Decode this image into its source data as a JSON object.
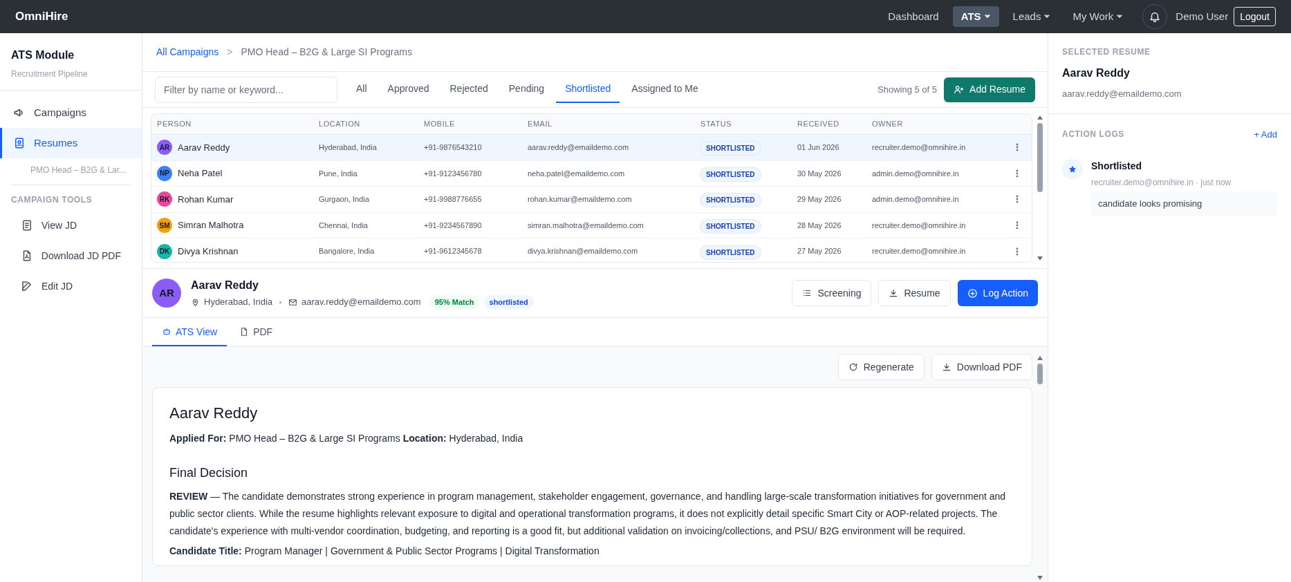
{
  "app": {
    "brand": "OmniHire",
    "nav": [
      {
        "label": "Dashboard",
        "selected": false,
        "dropdown": false
      },
      {
        "label": "ATS",
        "selected": true,
        "dropdown": true
      },
      {
        "label": "Leads",
        "selected": false,
        "dropdown": true
      },
      {
        "label": "My Work",
        "selected": false,
        "dropdown": true
      }
    ],
    "user": "Demo User",
    "logout": "Logout"
  },
  "sidebar": {
    "title": "ATS Module",
    "subtitle": "Recruitment Pipeline",
    "items": [
      {
        "label": "Campaigns",
        "selected": false
      },
      {
        "label": "Resumes",
        "selected": true
      }
    ],
    "sub_item": "PMO Head – B2G & Lar...",
    "tools_heading": "CAMPAIGN TOOLS",
    "tools": [
      {
        "label": "View JD"
      },
      {
        "label": "Download JD PDF"
      },
      {
        "label": "Edit JD"
      }
    ]
  },
  "breadcrumb": {
    "link": "All Campaigns",
    "separator": ">",
    "current": "PMO Head – B2G & Large SI Programs"
  },
  "filter": {
    "placeholder": "Filter by name or keyword...",
    "tabs": [
      {
        "label": "All",
        "selected": false
      },
      {
        "label": "Approved",
        "selected": false
      },
      {
        "label": "Rejected",
        "selected": false
      },
      {
        "label": "Pending",
        "selected": false
      },
      {
        "label": "Shortlisted",
        "selected": true
      },
      {
        "label": "Assigned to Me",
        "selected": false
      }
    ],
    "count": "Showing 5 of 5",
    "add_button": "Add Resume"
  },
  "table": {
    "columns": [
      "PERSON",
      "LOCATION",
      "MOBILE",
      "EMAIL",
      "STATUS",
      "RECEIVED",
      "OWNER"
    ],
    "rows": [
      {
        "initials": "AR",
        "color": "#8b5cf6",
        "name": "Aarav Reddy",
        "location": "Hyderabad, India",
        "mobile": "+91-9876543210",
        "email": "aarav.reddy@emaildemo.com",
        "status": "SHORTLISTED",
        "received": "01 Jun 2026",
        "owner": "recruiter.demo@omnihire.in",
        "selected": true
      },
      {
        "initials": "NP",
        "color": "#3b82f6",
        "name": "Neha Patel",
        "location": "Pune, India",
        "mobile": "+91-9123456780",
        "email": "neha.patel@emaildemo.com",
        "status": "SHORTLISTED",
        "received": "30 May 2026",
        "owner": "admin.demo@omnihire.in",
        "selected": false
      },
      {
        "initials": "RK",
        "color": "#ec4899",
        "name": "Rohan Kumar",
        "location": "Gurgaon, India",
        "mobile": "+91-9988776655",
        "email": "rohan.kumar@emaildemo.com",
        "status": "SHORTLISTED",
        "received": "29 May 2026",
        "owner": "admin.demo@omnihire.in",
        "selected": false
      },
      {
        "initials": "SM",
        "color": "#f59e0b",
        "name": "Simran Malhotra",
        "location": "Chennai, India",
        "mobile": "+91-9234567890",
        "email": "simran.malhotra@emaildemo.com",
        "status": "SHORTLISTED",
        "received": "28 May 2026",
        "owner": "recruiter.demo@omnihire.in",
        "selected": false
      },
      {
        "initials": "DK",
        "color": "#14b8a6",
        "name": "Divya Krishnan",
        "location": "Bangalore, India",
        "mobile": "+91-9612345678",
        "email": "divya.krishnan@emaildemo.com",
        "status": "SHORTLISTED",
        "received": "27 May 2026",
        "owner": "recruiter.demo@omnihire.in",
        "selected": false
      }
    ]
  },
  "detail": {
    "initials": "AR",
    "name": "Aarav Reddy",
    "location": "Hyderabad, India",
    "email": "aarav.reddy@emaildemo.com",
    "match": "95% Match",
    "status": "shortlisted",
    "buttons": [
      "Screening",
      "Resume"
    ],
    "primary_button": "Log Action",
    "tabs": [
      {
        "label": "ATS View",
        "selected": true
      },
      {
        "label": "PDF",
        "selected": false
      }
    ],
    "actions": [
      "Regenerate",
      "Download PDF"
    ]
  },
  "resume": {
    "name": "Aarav Reddy",
    "meta": "**Applied For:** PMO Head – B2G & Large SI Programs **Location:** Hyderabad, India",
    "section": "Final Decision",
    "decision": "**REVIEW** — The candidate demonstrates strong experience in program management, stakeholder engagement, governance, and handling large-scale transformation initiatives for government and public sector clients. While the resume highlights relevant exposure to digital and operational transformation programs, it does not explicitly detail specific Smart City or AOP-related projects. The candidate's experience with multi-vendor coordination, budgeting, and reporting is a good fit, but additional validation on invoicing/collections, and PSU/ B2G environment will be required.",
    "title_line": "**Candidate Title:** Program Manager |  Government & Public Sector Programs | Digital Transformation"
  },
  "right_panel": {
    "heading": "SELECTED RESUME",
    "name": "Aarav Reddy",
    "email": "aarav.reddy@emaildemo.com",
    "logs_heading": "ACTION LOGS",
    "add": "+ Add",
    "logs": [
      {
        "title": "Shortlisted",
        "meta": "recruiter.demo@omnihire.in · just now",
        "note": "candidate looks promising"
      }
    ]
  }
}
